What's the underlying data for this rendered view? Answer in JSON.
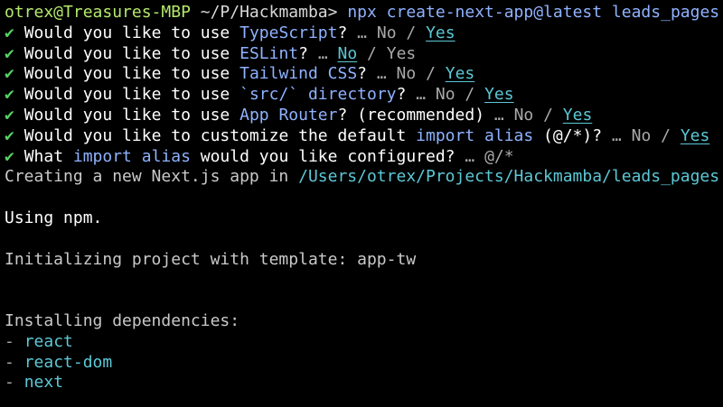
{
  "prompt": {
    "user_host": "otrex@Treasures-MBP",
    "cwd": "~/P/Hackmamba",
    "symbol": ">",
    "command": "npx create-next-app@latest leads_pages"
  },
  "check_mark": "✔",
  "ellipsis": "…",
  "separator": "/",
  "questions": [
    {
      "pre": "Would you like to use ",
      "highlight": "TypeScript",
      "post": "?",
      "opt1": "No",
      "opt2": "Yes",
      "selected": "Yes"
    },
    {
      "pre": "Would you like to use ",
      "highlight": "ESLint",
      "post": "?",
      "opt1": "No",
      "opt2": "Yes",
      "selected": "No"
    },
    {
      "pre": "Would you like to use ",
      "highlight": "Tailwind CSS",
      "post": "?",
      "opt1": "No",
      "opt2": "Yes",
      "selected": "Yes"
    },
    {
      "pre": "Would you like to use ",
      "highlight": "`src/` directory",
      "post": "?",
      "opt1": "No",
      "opt2": "Yes",
      "selected": "Yes"
    },
    {
      "pre": "Would you like to use ",
      "highlight": "App Router",
      "post": "? (recommended)",
      "opt1": "No",
      "opt2": "Yes",
      "selected": "Yes"
    },
    {
      "pre": "Would you like to customize the default ",
      "highlight": "import alias",
      "post": " (@/*)?",
      "opt1": "No",
      "opt2": "Yes",
      "selected": "Yes"
    }
  ],
  "alias_question": {
    "pre": "What ",
    "highlight": "import alias",
    "post": " would you like configured?",
    "answer": "@/*"
  },
  "creating": {
    "text": "Creating a new Next.js app in ",
    "path": "/Users/otrex/Projects/Hackmamba/leads_pages",
    "end": "."
  },
  "using": "Using npm.",
  "initializing": "Initializing project with template: app-tw",
  "installing": {
    "heading": "Installing dependencies:",
    "dash": "-",
    "deps": [
      "react",
      "react-dom",
      "next"
    ]
  }
}
